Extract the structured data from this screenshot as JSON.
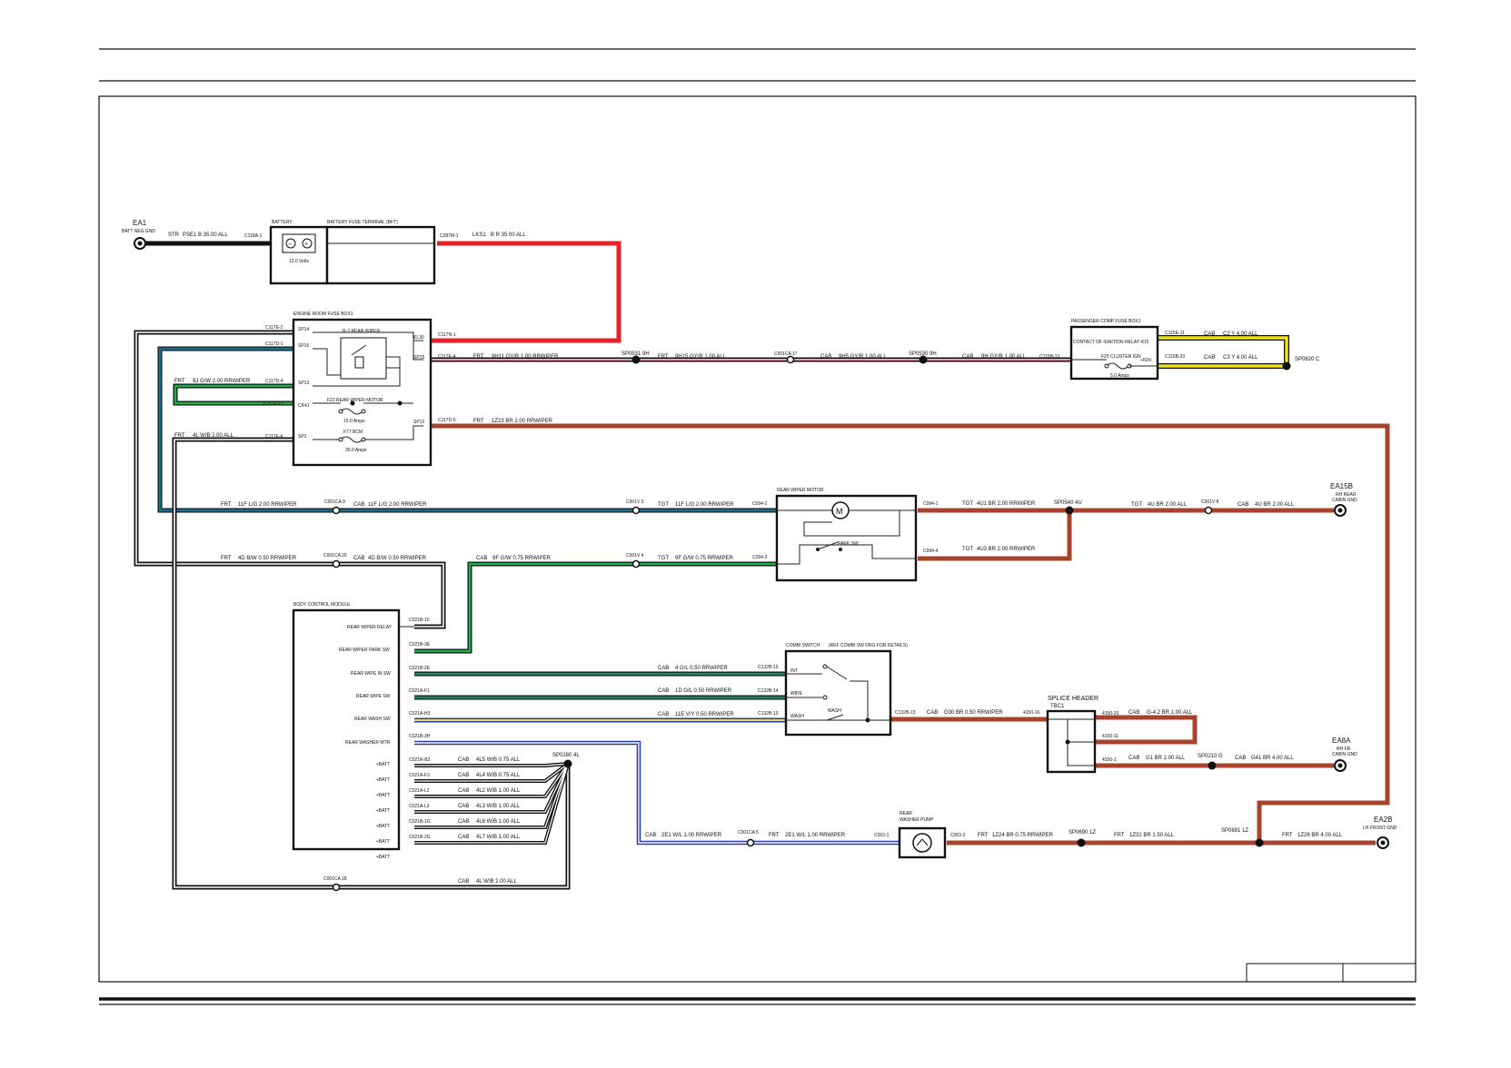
{
  "colors": {
    "red": "#e8202a",
    "brown": "#a8442c",
    "yellow": "#f2e21a",
    "green": "#21b04b",
    "teal": "#1d6f8e",
    "blue": "#2a3c9e",
    "gyr": "#e8a0a4",
    "black": "#111111"
  },
  "ground_points": {
    "ea1": {
      "name": "EA1",
      "desc": "BATT NEG GND"
    },
    "ea15b": {
      "name": "EA15B",
      "desc1": "RH REAR",
      "desc2": "CABIN GND"
    },
    "ea8a": {
      "name": "EA8A",
      "desc1": "RH FR",
      "desc2": "CABIN GND"
    },
    "ea2b": {
      "name": "EA2B",
      "desc": "LH FRONT GND"
    }
  },
  "battery": {
    "title": "BATTERY",
    "voltage": "12.0 Volts",
    "fuse_terminal": "BATTERY FUSE TERMINAL (BFT)"
  },
  "engine_fuse_box": {
    "title": "ENGINE ROOM FUSE BOX1",
    "relay": "R-2 REAR WIPER",
    "fuse_motor": "F23 REAR WIPER MOTOR",
    "fuse_motor_amps": "15.0 Amps",
    "fuse_bcm": "F77 BCM",
    "fuse_bcm_amps": "30.0 Amps",
    "pins": [
      "SP14",
      "SP16",
      "SP13",
      "CK41",
      "SP1",
      "KL30",
      "SP15",
      "SP12"
    ]
  },
  "passenger_fuse_box": {
    "title": "PASSENGER COMP FUSE BOX1",
    "relay": "CONTACT OF IGNITION RELAY R15",
    "fuse": "F25 CLUSTER IGN",
    "fuse_amps": "5.0 Amps",
    "ign": "+IGN"
  },
  "rear_wiper_motor": {
    "title": "REAR WIPER MOTOR",
    "park_sw": "PARK SW",
    "motor_symbol": "M"
  },
  "bcm": {
    "title": "BODY CONTROL MODULE",
    "pins": [
      "REAR WIPER RELAY",
      "REAR WIPER PARK SW",
      "REAR WIPE IN SW",
      "REAR WIPE SW",
      "REAR WASH SW",
      "REAR WASHER MTR",
      "+BATT",
      "+BATT",
      "+BATT",
      "+BATT",
      "+BATT",
      "+BATT",
      "+BATT"
    ],
    "connectors": [
      "C021B-10",
      "C021B-3E",
      "C021B-2E",
      "C021A-F1",
      "C021A-H3",
      "C021B-3H",
      "C021R-B2",
      "C021A-F3",
      "C021A-L2",
      "C021A-L3",
      "C021B-1G",
      "C021B-2G"
    ]
  },
  "combi_switch": {
    "title": "COMBI SWITCH",
    "note": "(REF COMBI SW DRG FOR DETAILS)",
    "positions": [
      "INT",
      "WIPE",
      "WASH"
    ],
    "wash_label": "WASH"
  },
  "splice_header": {
    "title1": "SPLICE HEADER",
    "title2": "TBC1",
    "pins": [
      "4150-20",
      "4150-11",
      "4150-1"
    ]
  },
  "washer_pump": {
    "title1": "REAR",
    "title2": "WASHER PUMP"
  },
  "wires": {
    "w_str": [
      "STR",
      "PSE1 B 35.00 ALL"
    ],
    "w_lks1": [
      "LKS1",
      "B R 35.00 ALL"
    ],
    "w_9h11": [
      "FRT",
      "9H11 GY/R 1.00 RRWIPER"
    ],
    "w_9h15": [
      "FRT",
      "9H15 GY/R 1.00 ALL"
    ],
    "w_9h5": [
      "CAB",
      "9H5 GY/R 1.00 ALL"
    ],
    "w_9h": [
      "CAB",
      "9H GY/R 1.00 ALL"
    ],
    "w_c2": [
      "CAB",
      "C2 Y 4.00 ALL"
    ],
    "w_c3": [
      "CAB",
      "C3 Y 4.00 ALL"
    ],
    "w_9j": [
      "FRT",
      "9J G/W 2.00 RRWIPER"
    ],
    "w_4l": [
      "FRT",
      "4L W/B 2.00 ALL"
    ],
    "w_1z23": [
      "FRT",
      "1Z23 BR 2.00 RRWIPER"
    ],
    "w_11f_frt": [
      "FRT",
      "11F L/G 2.00 RRWIPER"
    ],
    "w_11f_cab": [
      "CAB",
      "11F L/G 2.00 RRWIPER"
    ],
    "w_11f_tgt": [
      "TGT",
      "11F L/G 2.00 RRWIPER"
    ],
    "w_4u1": [
      "TGT",
      "4U1 BR 2.00 RRWIPER"
    ],
    "w_4u_tgt": [
      "TGT",
      "4U BR 2.00 ALL"
    ],
    "w_4u_cab": [
      "CAB",
      "4U BR 2.00 ALL"
    ],
    "w_4u3": [
      "TGT",
      "4U3 BR 2.00 RRWIPER"
    ],
    "w_4d_frt": [
      "FRT",
      "4D B/W 0.50 RRWIPER"
    ],
    "w_4d_cab": [
      "CAB",
      "4D B/W 0.50 RRWIPER"
    ],
    "w_9f_cab": [
      "CAB",
      "9F G/W 0.75 RRWIPER"
    ],
    "w_9f_tgt": [
      "TGT",
      "9F G/W 0.75 RRWIPER"
    ],
    "w_4gl": [
      "CAB",
      "4 G/L 0.50 RRWIPER"
    ],
    "w_1dgl": [
      "CAB",
      "1D G/L 0.50 RRWIPER"
    ],
    "w_11e": [
      "CAB",
      "11E V/Y 0.50 RRWIPER"
    ],
    "w_g30": [
      "CAB",
      "G30 BR 0.50 RRWIPER"
    ],
    "w_g42": [
      "CAB",
      "G-4.2 BR 1.00 ALL"
    ],
    "w_g1": [
      "CAB",
      "G1 BR 2.00 ALL"
    ],
    "w_g41": [
      "CAB",
      "G41 BR 4.00 ALL"
    ],
    "w_4l5": [
      "CAB",
      "4L5 W/B 0.75 ALL"
    ],
    "w_4l4": [
      "CAB",
      "4L4 W/B 0.75 ALL"
    ],
    "w_4l2": [
      "CAB",
      "4L2 W/B 1.00 ALL"
    ],
    "w_4l3": [
      "CAB",
      "4L3 W/B 1.00 ALL"
    ],
    "w_4l6": [
      "CAB",
      "4L6 W/B 1.00 ALL"
    ],
    "w_4l7": [
      "CAB",
      "4L7 W/B 1.00 ALL"
    ],
    "w_4l_cab": [
      "CAB",
      "4L W/B 2.00 ALL"
    ],
    "w_2e1_cab": [
      "CAB",
      "2E1 W/L 1.00 RRWIPER"
    ],
    "w_2e1_frt": [
      "FRT",
      "2E1 W/L 1.00 RRWIPER"
    ],
    "w_1z24": [
      "FRT",
      "1Z24 BR 0.75 RRWIPER"
    ],
    "w_1z31": [
      "FRT",
      "1Z31 BR 1.50 ALL"
    ],
    "w_1z26": [
      "FRT",
      "1Z26 BR 4.00 ALL"
    ]
  },
  "connectors": {
    "c118a1": "C118A-1",
    "c287m1": "C287M-1",
    "c117n1": "C117N-1",
    "c117e4": "C117E-4",
    "c117e2": "C117E-2",
    "c117d1": "C117D-1",
    "c117d4": "C117D-4",
    "c117f11": "C117F-11",
    "c117f4": "C117F-4",
    "c117d5": "C117D-5",
    "c001ca17": "C001CA 17",
    "c115b13": "C115B-13",
    "c115e11": "C115E-11",
    "c115b33": "C115B-33",
    "c001ca9": "C001CA 9",
    "c001v3": "C001V 3",
    "c094_2": "C094-2",
    "c094_1": "C094-1",
    "c001v8": "C001V 8",
    "c001ca20": "C001CA 20",
    "c001v4": "C001V 4",
    "c094_3": "C094-3",
    "c094_4": "C094-4",
    "c132b15": "C132B-15",
    "c132b14": "C132B-14",
    "c132b10": "C132B-10",
    "c132b13": "C132B-13",
    "c4150_16": "4150-16",
    "c001ca5": "C001CA 5",
    "c053_1": "C053-1",
    "c053_2": "C053-2",
    "c001ca18": "C001CA 18"
  },
  "splices": {
    "sp0531": "SP0531 9H",
    "sp0530": "SP0530 9H",
    "sp0820": "SP0820 C",
    "sp0540": "SP0540 4U",
    "sp0280": "SP0280 4L",
    "sp0210": "SP0210 G",
    "sp0690": "SP0690 1Z",
    "sp0691": "SP0691 1Z"
  }
}
